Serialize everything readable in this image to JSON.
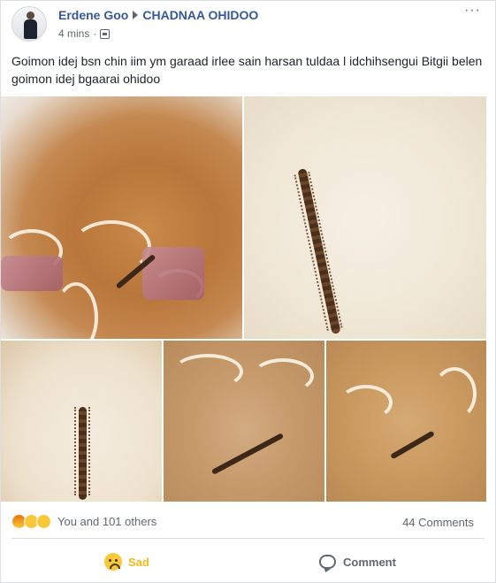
{
  "post": {
    "author": "Erdene Goo",
    "group": "CHADNAA OHIDOO",
    "timestamp": "4 mins",
    "privacy_icon": "group-audience-icon",
    "more_icon": "more-options-icon",
    "text": "Goimon idej bsn chin iim ym garaad irlee sain harsan tuldaa l idchihsengui Bitgii belen goimon idej bgaarai ohidoo"
  },
  "photos": [
    "photo-1",
    "photo-2",
    "photo-3",
    "photo-4",
    "photo-5"
  ],
  "reactions": {
    "icons": [
      "angry-reaction-icon",
      "wow-reaction-icon",
      "sad-reaction-icon"
    ],
    "summary": "You and 101 others",
    "comments": "44 Comments"
  },
  "actions": {
    "reaction_label": "Sad",
    "comment_label": "Comment"
  },
  "colors": {
    "link": "#365899",
    "sad": "#f0ba15",
    "meta": "#606770"
  }
}
